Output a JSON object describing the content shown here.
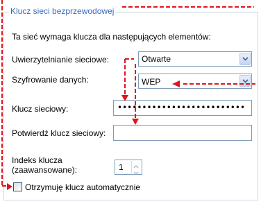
{
  "group": {
    "title": "Klucz sieci bezprzewodowej"
  },
  "intro_text": "Ta sieć wymaga klucza dla następujących elementów:",
  "auth": {
    "label": "Uwierzytelnianie sieciowe:",
    "value": "Otwarte"
  },
  "encryption": {
    "label": "Szyfrowanie danych:",
    "value": "WEP"
  },
  "network_key": {
    "label": "Klucz sieciowy:",
    "value": "••••••••••••••••••••••••••"
  },
  "confirm_key": {
    "label": "Potwierdź klucz sieciowy:",
    "value": ""
  },
  "key_index": {
    "label_line1": "Indeks klucza",
    "label_line2": "(zaawansowane):",
    "value": "1"
  },
  "auto_key": {
    "label": "Otrzymuję klucz automatycznie",
    "checked": false
  },
  "colors": {
    "annotation_red": "#e0141e",
    "group_title_blue": "#3a6cc0",
    "field_border": "#7f9db9"
  }
}
